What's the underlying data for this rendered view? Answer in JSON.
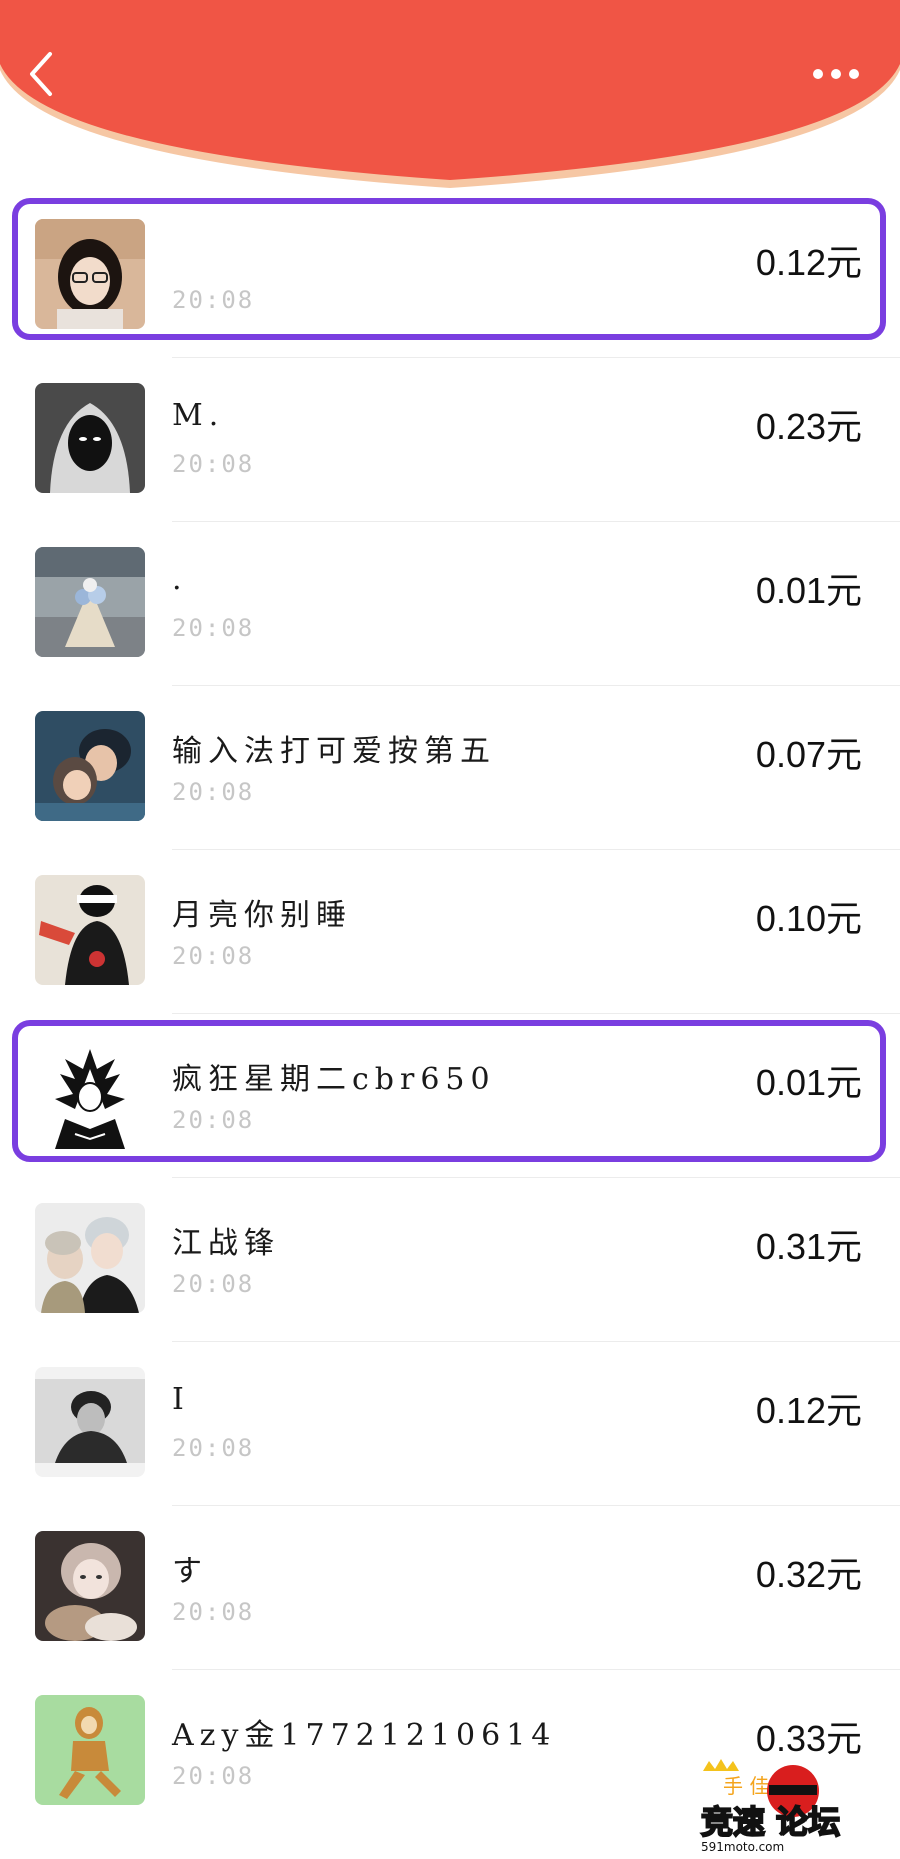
{
  "colors": {
    "header_red": "#f05545",
    "header_edge": "#f6c7a4",
    "highlight": "#7a3ee0",
    "time_gray": "#c6c6c6"
  },
  "header": {
    "back_icon": "chevron-left-icon",
    "more_icon": "more-dots-icon"
  },
  "list": [
    {
      "name": "",
      "time": "20:08",
      "amount": "0.12元",
      "highlighted": true
    },
    {
      "name": "M.",
      "time": "20:08",
      "amount": "0.23元",
      "highlighted": false
    },
    {
      "name": ".",
      "time": "20:08",
      "amount": "0.01元",
      "highlighted": false
    },
    {
      "name": "输入法打可爱按第五",
      "time": "20:08",
      "amount": "0.07元",
      "highlighted": false
    },
    {
      "name": "月亮你别睡",
      "time": "20:08",
      "amount": "0.10元",
      "highlighted": false
    },
    {
      "name": "疯狂星期二cbr650",
      "time": "20:08",
      "amount": "0.01元",
      "highlighted": true
    },
    {
      "name": "江战锋",
      "time": "20:08",
      "amount": "0.31元",
      "highlighted": false
    },
    {
      "name": "I",
      "time": "20:08",
      "amount": "0.12元",
      "highlighted": false
    },
    {
      "name": "す",
      "time": "20:08",
      "amount": "0.32元",
      "highlighted": false
    },
    {
      "name": "Azy金17721210614",
      "time": "20:08",
      "amount": "0.33元",
      "highlighted": false
    }
  ],
  "watermark": {
    "line1": "手 佳",
    "line2": "竞速 论坛",
    "site": "591moto.com"
  }
}
